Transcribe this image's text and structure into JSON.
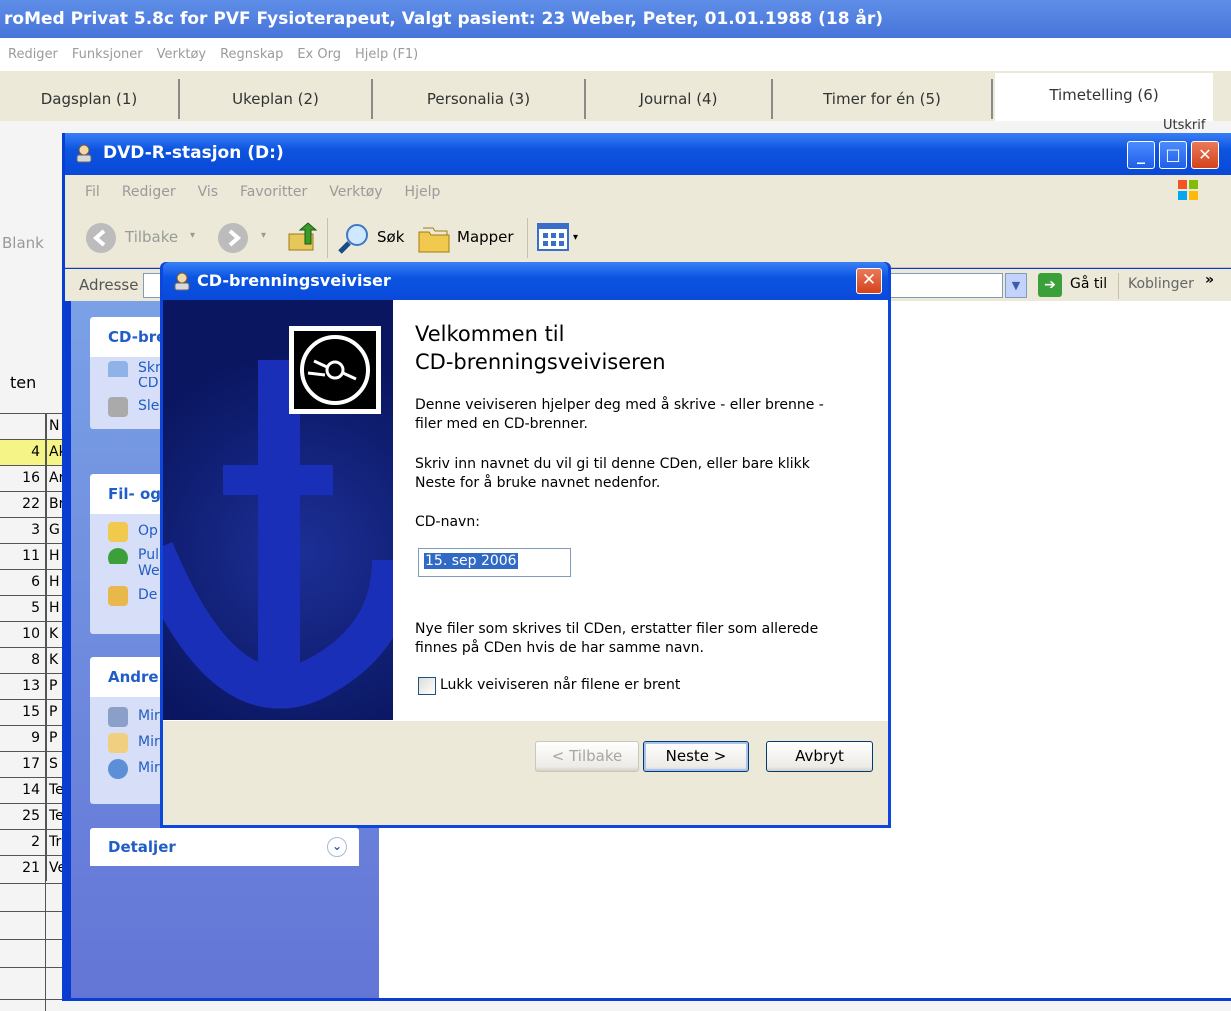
{
  "app": {
    "title": "roMed Privat 5.8c for PVF Fysioterapeut,  Valgt pasient: 23 Weber, Peter, 01.01.1988  (18 år)",
    "menu": [
      "Rediger",
      "Funksjoner",
      "Verktøy",
      "Regnskap",
      "Ex Org",
      "Hjelp (F1)"
    ],
    "tabs": [
      "Dagsplan (1)",
      "Ukeplan (2)",
      "Personalia (3)",
      "Journal (4)",
      "Timer for én (5)",
      "Timetelling (6)"
    ],
    "utskrift": "Utskrif",
    "blank_label": "Blank",
    "ten_label": "ten",
    "list_header": "N",
    "list_rows": [
      {
        "num": "4",
        "code": "Ak"
      },
      {
        "num": "16",
        "code": "Ar"
      },
      {
        "num": "22",
        "code": "Br"
      },
      {
        "num": "3",
        "code": "G"
      },
      {
        "num": "11",
        "code": "H"
      },
      {
        "num": "6",
        "code": "H"
      },
      {
        "num": "5",
        "code": "H"
      },
      {
        "num": "10",
        "code": "K"
      },
      {
        "num": "8",
        "code": "K"
      },
      {
        "num": "13",
        "code": "P"
      },
      {
        "num": "15",
        "code": "P"
      },
      {
        "num": "9",
        "code": "P"
      },
      {
        "num": "17",
        "code": "S"
      },
      {
        "num": "14",
        "code": "Te"
      },
      {
        "num": "25",
        "code": "Te"
      },
      {
        "num": "2",
        "code": "Tr"
      },
      {
        "num": "21",
        "code": "Ve"
      }
    ]
  },
  "explorer": {
    "title": "DVD-R-stasjon (D:)",
    "menu": [
      "Fil",
      "Rediger",
      "Vis",
      "Favoritter",
      "Verktøy",
      "Hjelp"
    ],
    "toolbar": {
      "back": "Tilbake",
      "search": "Søk",
      "folders": "Mapper"
    },
    "address_label": "Adresse",
    "goto_label": "Gå til",
    "links_label": "Koblinger",
    "panels": {
      "cd": {
        "title": "CD-bre",
        "items": [
          "Skr",
          "CD",
          "Sle"
        ]
      },
      "file": {
        "title": "Fil- og",
        "items": [
          "Op",
          "Pul",
          "We",
          "De"
        ]
      },
      "other": {
        "title": "Andre",
        "items": [
          "Mir",
          "Mir",
          "Mir"
        ]
      },
      "details": {
        "title": "Detaljer"
      }
    }
  },
  "wizard": {
    "title": "CD-brenningsveiviser",
    "heading": "Velkommen til\nCD-brenningsveiviseren",
    "intro": "Denne veiviseren hjelper deg med å skrive - eller brenne -\nfiler med en CD-brenner.",
    "instruction": "Skriv inn navnet du vil gi til denne CDen, eller bare klikk\nNeste for å bruke navnet nedenfor.",
    "cd_name_label": "CD-navn:",
    "cd_name_value": "15. sep 2006",
    "overwrite_note": "Nye filer som skrives til CDen, erstatter filer som allerede\nfinnes på CDen hvis de har samme navn.",
    "close_checkbox_label": "Lukk veiviseren når filene er brent",
    "close_checkbox_checked": false,
    "buttons": {
      "back": "< Tilbake",
      "next": "Neste >",
      "cancel": "Avbryt"
    }
  },
  "colors": {
    "xp_blue": "#0a3ccf",
    "panel_blue": "#215dc6",
    "highlight_row": "#f5f587"
  }
}
